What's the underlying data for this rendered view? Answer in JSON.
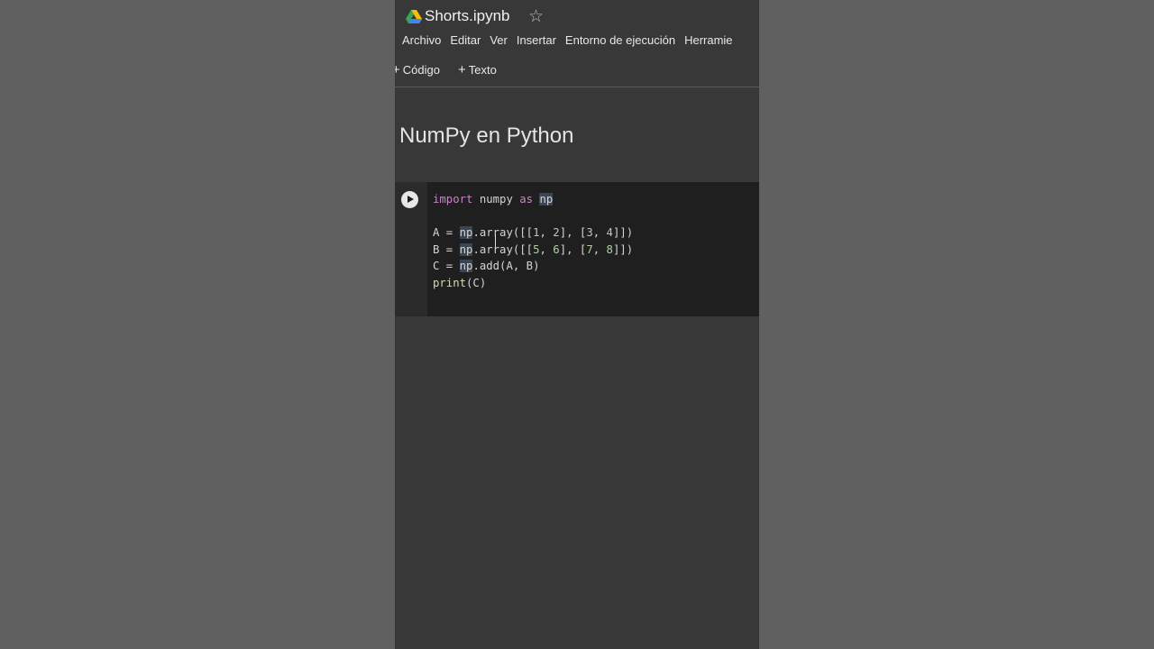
{
  "file": {
    "name": "Shorts.ipynb"
  },
  "menu": [
    "Archivo",
    "Editar",
    "Ver",
    "Insertar",
    "Entorno de ejecución",
    "Herramie"
  ],
  "toolbar": {
    "code_label": "Código",
    "text_label": "Texto"
  },
  "notebook": {
    "heading": "NumPy en Python"
  },
  "code_cell": {
    "lines": [
      "import numpy as np",
      "",
      "A = np.array([[1, 2], [3, 4]])",
      "B = np.array([[5, 6], [7, 8]])",
      "C = np.add(A, B)",
      "print(C)"
    ]
  },
  "colors": {
    "background": "#383838",
    "cell_background": "#1f1f1f",
    "keyword": "#c586c0",
    "number": "#b5cea8"
  }
}
